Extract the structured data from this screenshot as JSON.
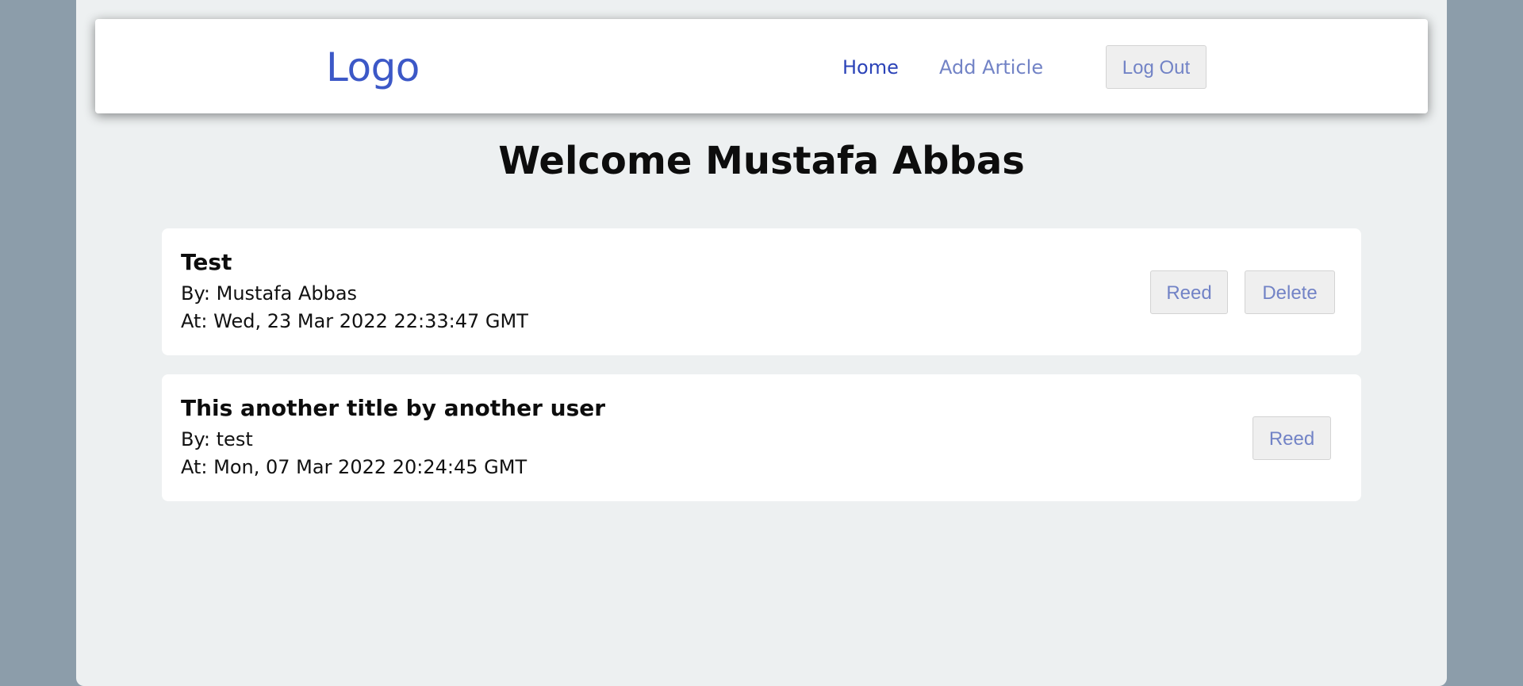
{
  "navbar": {
    "logo": "Logo",
    "links": [
      {
        "label": "Home"
      },
      {
        "label": "Add Article"
      }
    ],
    "logout_label": "Log Out"
  },
  "main": {
    "welcome": "Welcome Mustafa Abbas",
    "articles": [
      {
        "title": "Test",
        "author": "By: Mustafa Abbas",
        "date": "At: Wed, 23 Mar 2022 22:33:47 GMT",
        "read_label": "Reed",
        "delete_label": "Delete"
      },
      {
        "title": "This another title by another user",
        "author": "By: test",
        "date": "At: Mon, 07 Mar 2022 20:24:45 GMT",
        "read_label": "Reed"
      }
    ]
  },
  "colors": {
    "page_bg": "#8c9daa",
    "app_bg": "#edf0f1",
    "logo": "#3c58c7",
    "nav_active": "#2b43b8",
    "nav_inactive": "#7283c6",
    "button_text": "#7283c6"
  }
}
